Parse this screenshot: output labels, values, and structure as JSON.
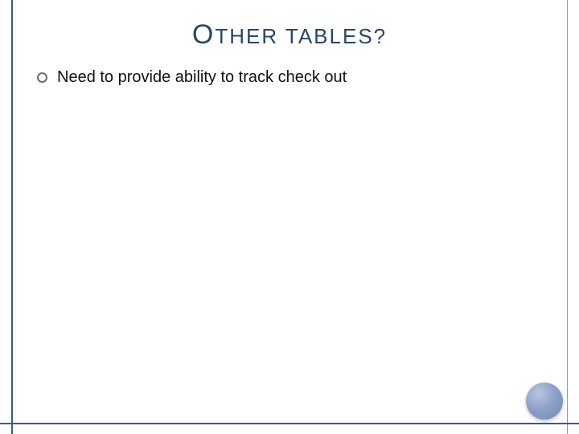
{
  "title": {
    "cap1": "O",
    "word1_rest": "THER",
    "space": " ",
    "word2": "TABLES",
    "punct": "?"
  },
  "bullets": [
    {
      "text": "Need to provide ability to track check out"
    }
  ],
  "colors": {
    "accent": "#3d5a80",
    "title": "#28466b"
  }
}
